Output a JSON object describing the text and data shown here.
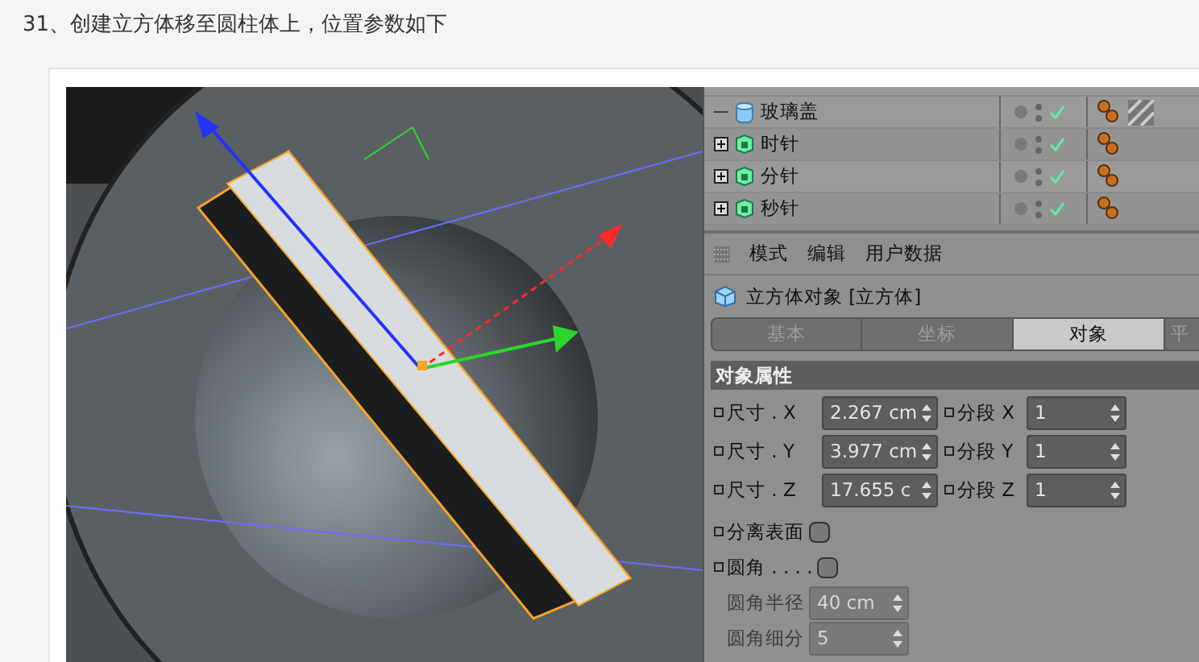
{
  "heading": "31、创建立方体移至圆柱体上，位置参数如下",
  "object_list": [
    {
      "name": "玻璃盖",
      "kind": "cylinder",
      "expandable": false,
      "visible": true,
      "hatched_tag": true
    },
    {
      "name": "时针",
      "kind": "group",
      "expandable": true,
      "visible": true,
      "hatched_tag": false
    },
    {
      "name": "分针",
      "kind": "group",
      "expandable": true,
      "visible": true,
      "hatched_tag": false
    },
    {
      "name": "秒针",
      "kind": "group",
      "expandable": true,
      "visible": true,
      "hatched_tag": false
    }
  ],
  "menu": [
    "模式",
    "编辑",
    "用户数据"
  ],
  "object_title": "立方体对象 [立方体]",
  "tabs": [
    {
      "label": "基本",
      "selected": false
    },
    {
      "label": "坐标",
      "selected": false
    },
    {
      "label": "对象",
      "selected": true
    },
    {
      "label": "平",
      "selected": false
    }
  ],
  "section_title": "对象属性",
  "size_rows": [
    {
      "label": "尺寸 . X",
      "value": "2.267 cm",
      "segment_label": "分段 X",
      "segment_value": "1"
    },
    {
      "label": "尺寸 . Y",
      "value": "3.977 cm",
      "segment_label": "分段 Y",
      "segment_value": "1"
    },
    {
      "label": "尺寸 . Z",
      "value": "17.655 c",
      "segment_label": "分段 Z",
      "segment_value": "1"
    }
  ],
  "options": [
    {
      "label": "分离表面",
      "checked": false
    },
    {
      "label": "圆角 . . . .",
      "checked": false
    }
  ],
  "disabled_fields": [
    {
      "label": "圆角半径",
      "value": "40 cm"
    },
    {
      "label": "圆角细分",
      "value": "5"
    }
  ]
}
